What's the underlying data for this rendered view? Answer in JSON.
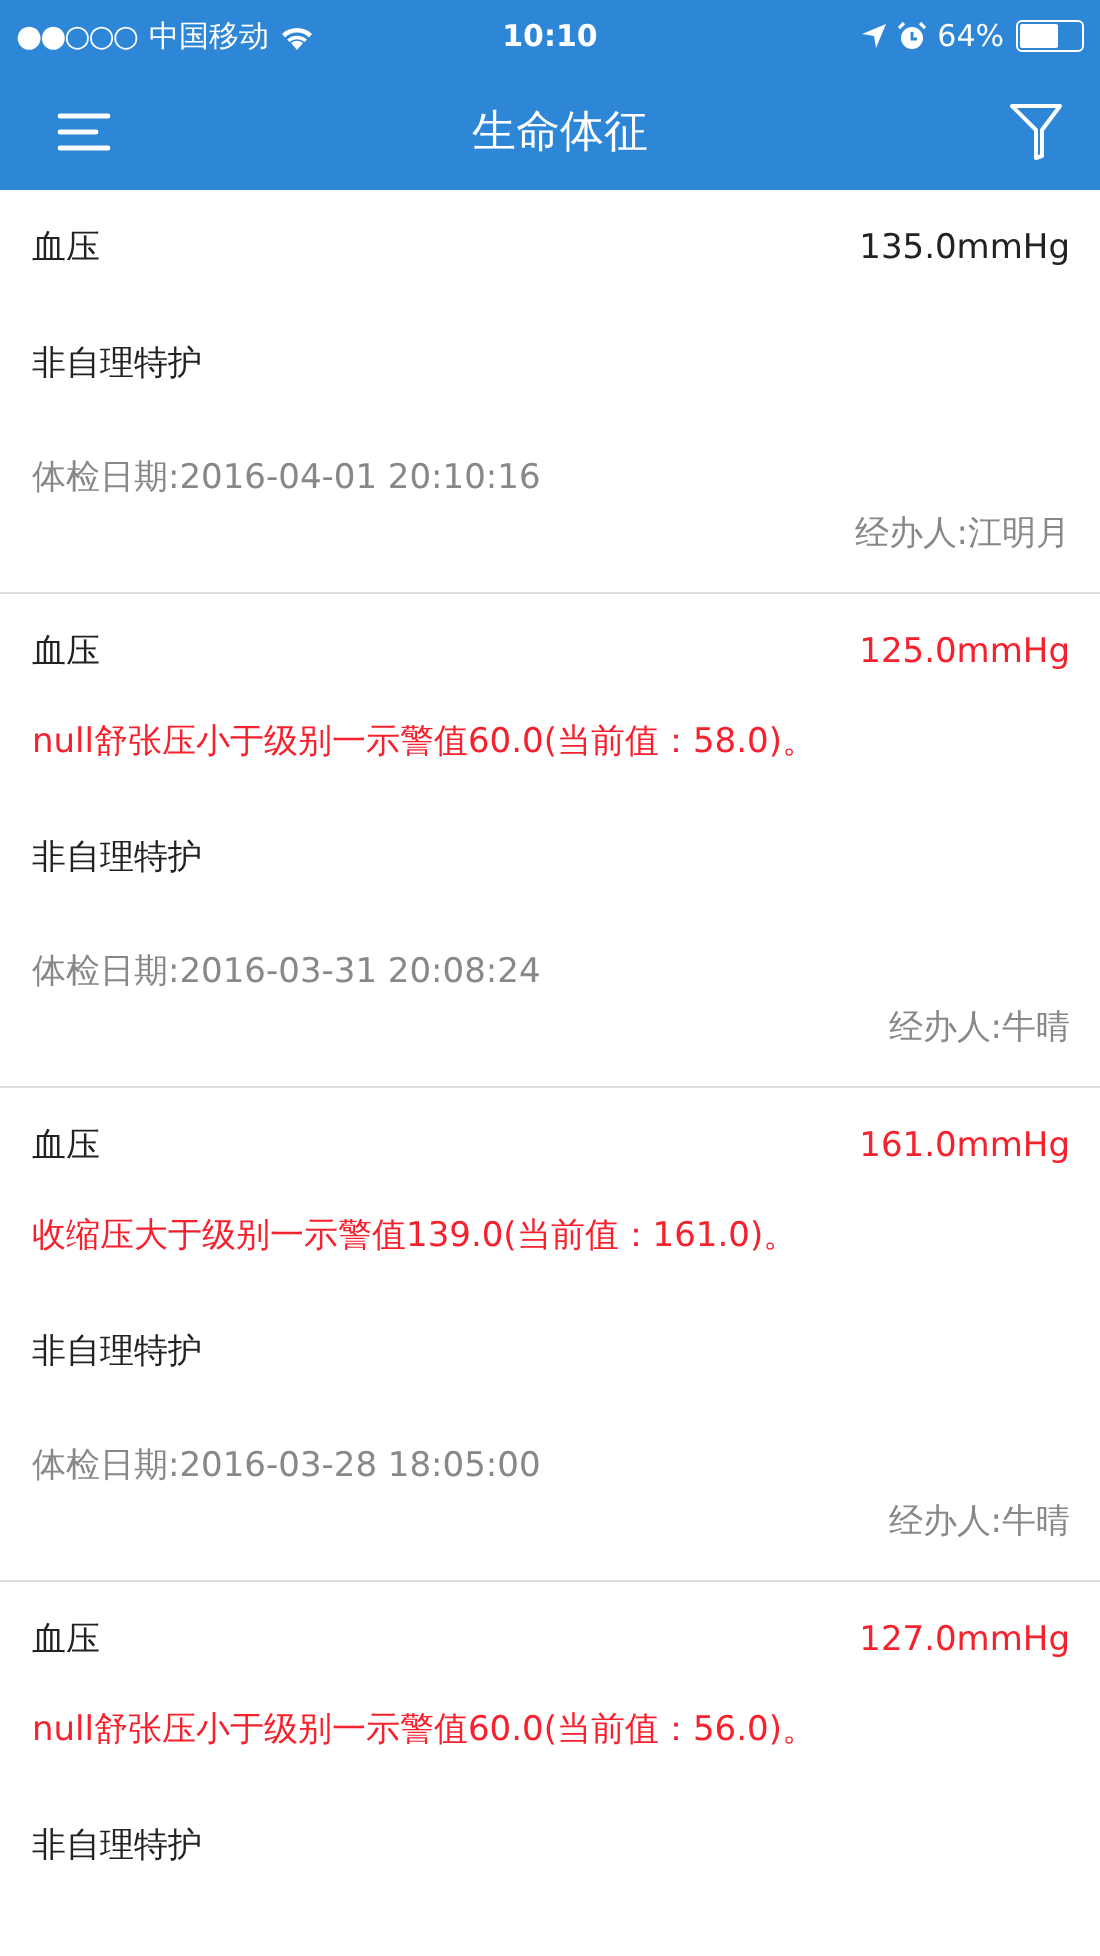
{
  "status_bar": {
    "signal_dots": "●●○○○",
    "carrier": "中国移动",
    "time": "10:10",
    "battery": "64%"
  },
  "nav": {
    "title": "生命体征"
  },
  "records": [
    {
      "name": "血压",
      "value": "135.0mmHg",
      "abnormal": false,
      "care": "非自理特护",
      "date": "体检日期:2016-04-01 20:10:16",
      "handler": "经办人:江明月"
    },
    {
      "name": "血压",
      "value": "125.0mmHg",
      "abnormal": true,
      "alert": "null舒张压小于级别一示警值60.0(当前值：58.0)。",
      "care": "非自理特护",
      "date": "体检日期:2016-03-31 20:08:24",
      "handler": "经办人:牛晴"
    },
    {
      "name": "血压",
      "value": "161.0mmHg",
      "abnormal": true,
      "alert": "收缩压大于级别一示警值139.0(当前值：161.0)。",
      "care": "非自理特护",
      "date": "体检日期:2016-03-28 18:05:00",
      "handler": "经办人:牛晴"
    },
    {
      "name": "血压",
      "value": "127.0mmHg",
      "abnormal": true,
      "alert": "null舒张压小于级别一示警值60.0(当前值：56.0)。",
      "care": "非自理特护"
    }
  ]
}
